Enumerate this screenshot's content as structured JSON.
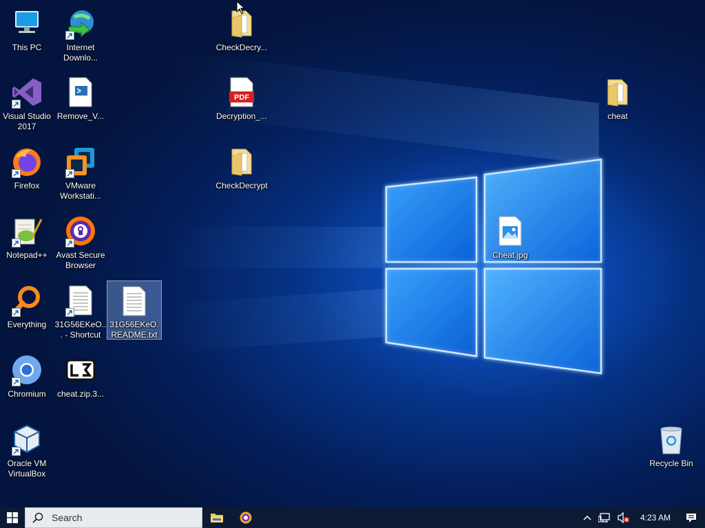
{
  "desktop": {
    "icons": [
      {
        "id": "this-pc",
        "label": "This PC",
        "kind": "pc",
        "shortcut": false
      },
      {
        "id": "idm",
        "label": "Internet Downlo...",
        "kind": "idm",
        "shortcut": true
      },
      {
        "id": "checkdecry-1",
        "label": "CheckDecry...",
        "kind": "folder",
        "shortcut": false
      },
      {
        "id": "visual-studio",
        "label": "Visual Studio 2017",
        "kind": "vs",
        "shortcut": true
      },
      {
        "id": "remove-v",
        "label": "Remove_V...",
        "kind": "script",
        "shortcut": false
      },
      {
        "id": "decryption-pdf",
        "label": "Decryption_...",
        "kind": "pdf",
        "shortcut": false
      },
      {
        "id": "cheat-folder",
        "label": "cheat",
        "kind": "folder",
        "shortcut": false
      },
      {
        "id": "firefox",
        "label": "Firefox",
        "kind": "firefox",
        "shortcut": true
      },
      {
        "id": "vmware",
        "label": "VMware Workstati...",
        "kind": "vmware",
        "shortcut": true
      },
      {
        "id": "checkdecrypt",
        "label": "CheckDecrypt",
        "kind": "folder",
        "shortcut": false
      },
      {
        "id": "notepadpp",
        "label": "Notepad++",
        "kind": "notepadpp",
        "shortcut": true
      },
      {
        "id": "avast",
        "label": "Avast Secure Browser",
        "kind": "avast",
        "shortcut": true
      },
      {
        "id": "cheat-jpg",
        "label": "Cheat.jpg",
        "kind": "image",
        "shortcut": false
      },
      {
        "id": "everything",
        "label": "Everything",
        "kind": "everything",
        "shortcut": true
      },
      {
        "id": "readme-shortcut",
        "label": "31G56EKeO... - Shortcut",
        "kind": "textdoc",
        "shortcut": true
      },
      {
        "id": "readme-txt",
        "label": "31G56EKeO.README.txt",
        "kind": "textdoc",
        "shortcut": false,
        "selected": true
      },
      {
        "id": "chromium",
        "label": "Chromium",
        "kind": "chromium",
        "shortcut": true
      },
      {
        "id": "cheat-zip",
        "label": "cheat.zip.3...",
        "kind": "zip",
        "shortcut": false
      },
      {
        "id": "virtualbox",
        "label": "Oracle VM VirtualBox",
        "kind": "vbox",
        "shortcut": true
      },
      {
        "id": "recycle-bin",
        "label": "Recycle Bin",
        "kind": "recycle",
        "shortcut": false
      }
    ]
  },
  "taskbar": {
    "search_placeholder": "Search",
    "pinned": [
      {
        "id": "file-explorer",
        "icon": "folder-icon"
      },
      {
        "id": "chromium-tb",
        "icon": "chromium-icon"
      }
    ],
    "clock": "4:23 AM"
  },
  "colors": {
    "taskbar": "#0d1a33",
    "accent": "#1e90ff"
  }
}
